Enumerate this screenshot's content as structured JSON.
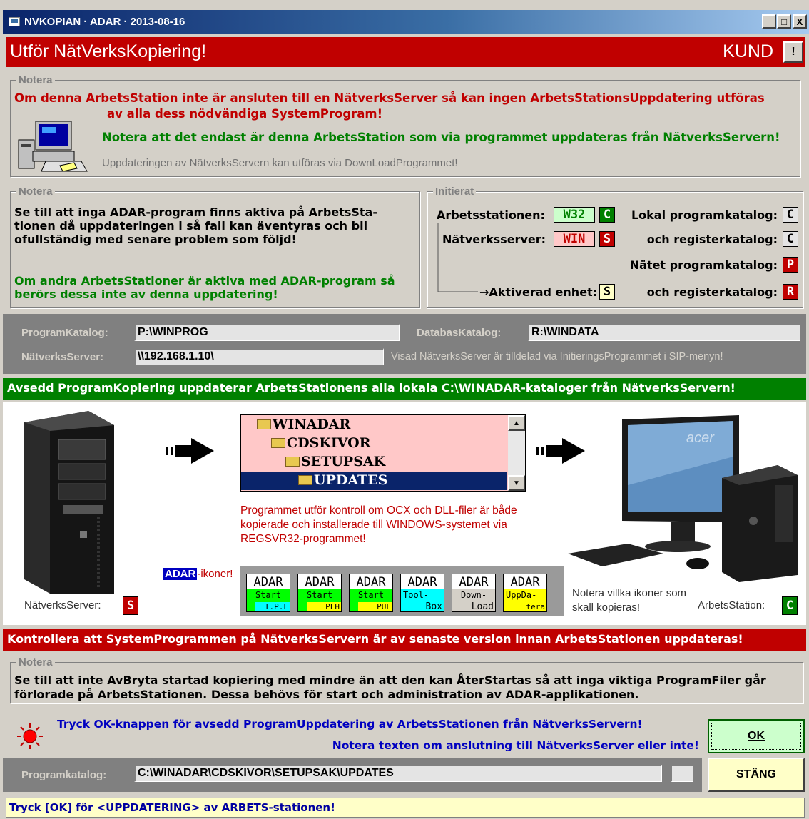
{
  "window": {
    "title": "NVKOPIAN · ADAR · 2013-08-16",
    "controls": {
      "minimize": "_",
      "maximize": "□",
      "close": "X"
    }
  },
  "header": {
    "title": "Utför NätVerksKopiering!",
    "right_label": "KUND",
    "flag_button": "!"
  },
  "note1": {
    "legend": "Notera",
    "line1": "Om denna ArbetsStation inte är ansluten till en NätverksServer så kan ingen ArbetsStationsUppdatering utföras",
    "line2": "av alla dess nödvändiga SystemProgram!",
    "line3": "Notera att det endast är denna ArbetsStation som via programmet uppdateras från NätverksServern!",
    "line4": "Uppdateringen av NätverksServern kan utföras via DownLoadProgrammet!"
  },
  "note2": {
    "legend": "Notera",
    "p1": "Se till att inga ADAR-program finns aktiva på ArbetsSta- tionen då uppdateringen i så fall kan äventyras och bli ofullständig med senare problem som följd!",
    "p2": "Om andra ArbetsStationer är aktiva med ADAR-program så berörs dessa inte av denna uppdatering!"
  },
  "initierat": {
    "legend": "Initierat",
    "ws_label": "Arbetsstationen:",
    "ws_value": "W32",
    "ws_letter": "C",
    "ns_label": "Nätverksserver:",
    "ns_value": "WIN",
    "ns_letter": "S",
    "dev_label": "→Aktiverad enhet:",
    "dev_value": "S",
    "lp_label": "Lokal programkatalog:",
    "lp_value": "C",
    "lr_label": "och registerkatalog:",
    "lr_value": "C",
    "np_label": "Nätet programkatalog:",
    "np_value": "P",
    "nr_label": "och registerkatalog:",
    "nr_value": "R"
  },
  "paths": {
    "prog_label": "ProgramKatalog:",
    "prog_value": "P:\\WINPROG",
    "db_label": "DatabasKatalog:",
    "db_value": "R:\\WINDATA",
    "server_label": "NätverksServer:",
    "server_value": "\\\\192.168.1.10\\",
    "server_note": "Visad NätverksServer är tilldelad via InitieringsProgrammet i SIP-menyn!"
  },
  "banner_green": "Avsedd ProgramKopiering uppdaterar ArbetsStationens alla lokala C:\\WINADAR-kataloger från NätverksServern!",
  "tree": [
    "WINADAR",
    "CDSKIVOR",
    "SETUPSAK",
    "UPDATES"
  ],
  "panel": {
    "info": "Programmet utför kontroll om OCX och DLL-filer är både kopierade och installerade till WINDOWS-systemet via REGSVR32-programmet!",
    "adar_tag": "ADAR",
    "adar_suffix": "-ikoner!",
    "server_label": "NätverksServer:",
    "server_letter": "S",
    "ws_label": "ArbetsStation:",
    "ws_letter": "C",
    "icons_note": "Notera villka ikoner som skall kopieras!",
    "icon_top": "ADAR",
    "icons": [
      {
        "l1": "Start",
        "l2": "I.P.L",
        "c1": "#00ff00",
        "c2": "#00ffff"
      },
      {
        "l1": "Start",
        "l2": "PLH",
        "c1": "#00ff00",
        "c2": "#ffff00"
      },
      {
        "l1": "Start",
        "l2": "PUL",
        "c1": "#00ff00",
        "c2": "#ffff00"
      },
      {
        "l1": "Tool-",
        "l2": "Box",
        "c1": "#00ffff",
        "c2": "#00ffff"
      },
      {
        "l1": "Down-",
        "l2": "Load",
        "c1": "#d4d0c8",
        "c2": "#d4d0c8"
      },
      {
        "l1": "UppDa-",
        "l2": "tera",
        "c1": "#ffff00",
        "c2": "#ffff00"
      }
    ]
  },
  "banner_red": "Kontrollera att SystemProgrammen på NätverksServern är av senaste version innan ArbetsStationen uppdateras!",
  "note3": {
    "legend": "Notera",
    "text": "Se till att inte AvBryta startad kopiering med mindre än att den kan ÅterStartas så att inga viktiga ProgramFiler går förlorade på ArbetsStationen. Dessa behövs för start och administration av ADAR-applikationen."
  },
  "action": {
    "line1": "Tryck OK-knappen för avsedd ProgramUppdatering av ArbetsStationen från NätverksServern!",
    "line2": "Notera texten om anslutning till NätverksServer eller inte!",
    "ok_label": "OK",
    "prog_label": "Programkatalog:",
    "prog_value": "C:\\WINADAR\\CDSKIVOR\\SETUPSAK\\UPDATES",
    "close_label": "STÄNG"
  },
  "status": "Tryck [OK] för <UPPDATERING> av ARBETS-stationen!"
}
